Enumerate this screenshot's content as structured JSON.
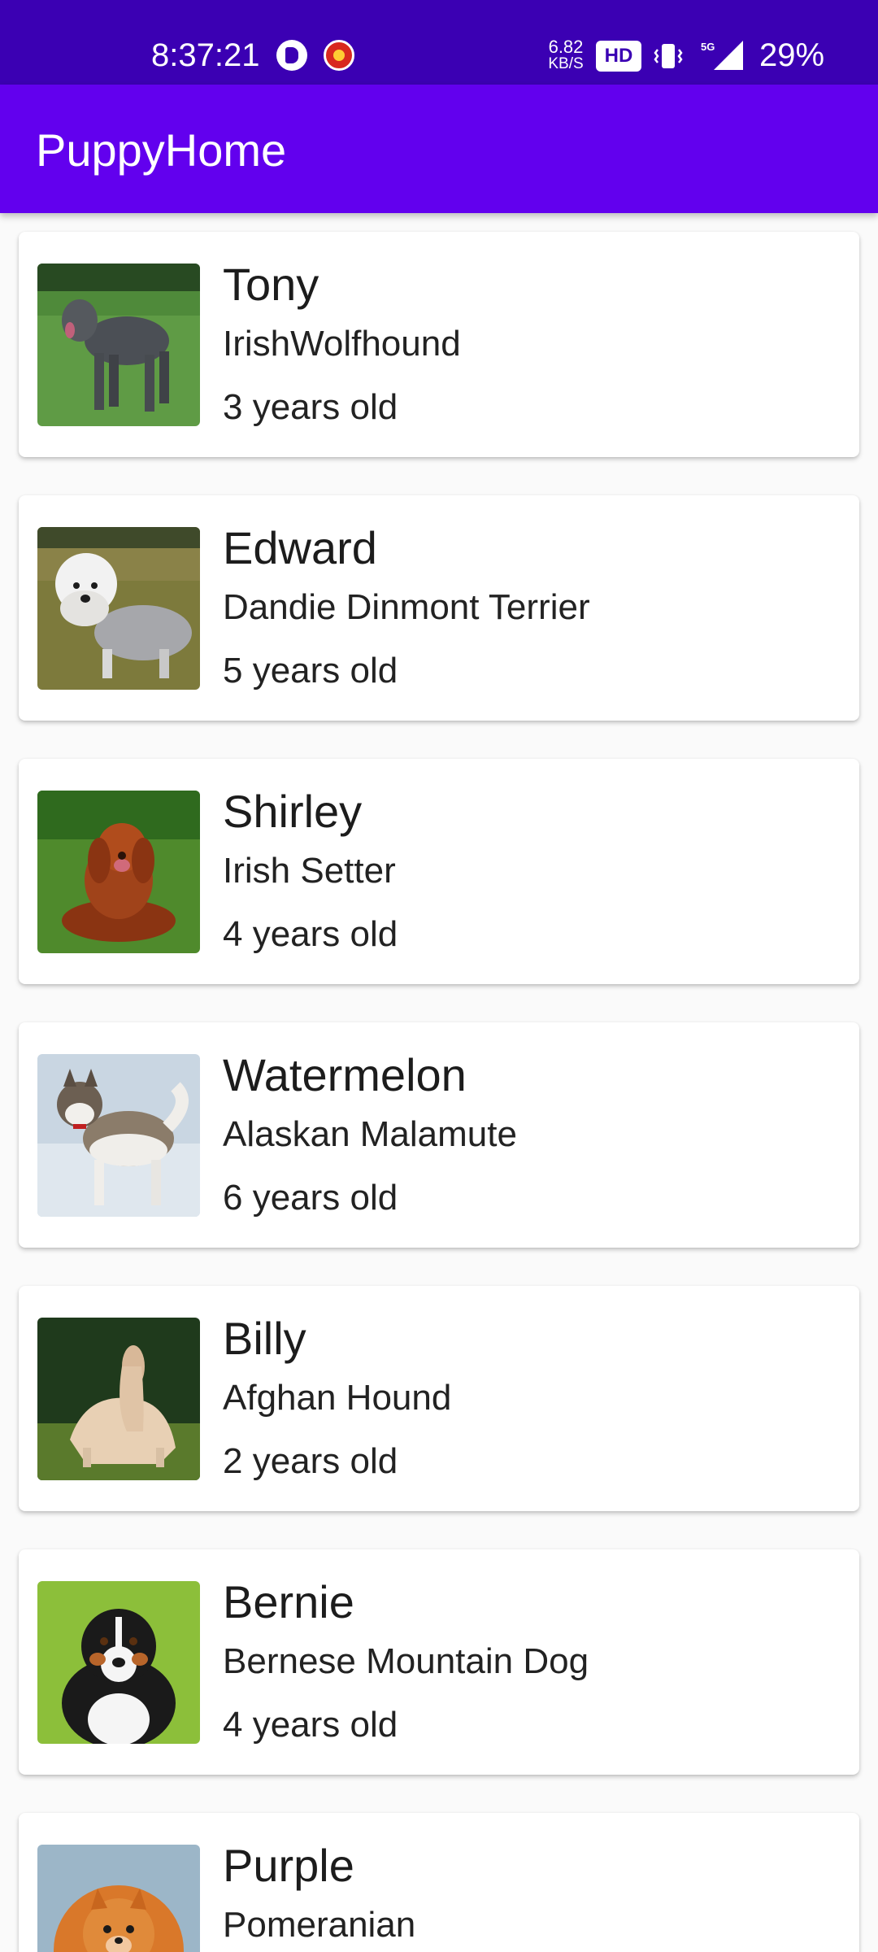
{
  "status_bar": {
    "time": "8:37:21",
    "speed_value": "6.82",
    "speed_unit": "KB/S",
    "hd_label": "HD",
    "network_label": "5G",
    "battery": "29%"
  },
  "app_bar": {
    "title": "PuppyHome"
  },
  "colors": {
    "status_bar": "#3b00b3",
    "app_bar": "#6200ee",
    "background": "#fafafa"
  },
  "dogs": [
    {
      "name": "Tony",
      "breed": "IrishWolfhound",
      "age": "3 years old"
    },
    {
      "name": "Edward",
      "breed": "Dandie Dinmont Terrier",
      "age": "5 years old"
    },
    {
      "name": "Shirley",
      "breed": "Irish Setter",
      "age": "4 years old"
    },
    {
      "name": "Watermelon",
      "breed": "Alaskan Malamute",
      "age": "6 years old"
    },
    {
      "name": "Billy",
      "breed": "Afghan Hound",
      "age": "2 years old"
    },
    {
      "name": "Bernie",
      "breed": "Bernese Mountain Dog",
      "age": "4 years old"
    },
    {
      "name": "Purple",
      "breed": "Pomeranian",
      "age": ""
    }
  ]
}
